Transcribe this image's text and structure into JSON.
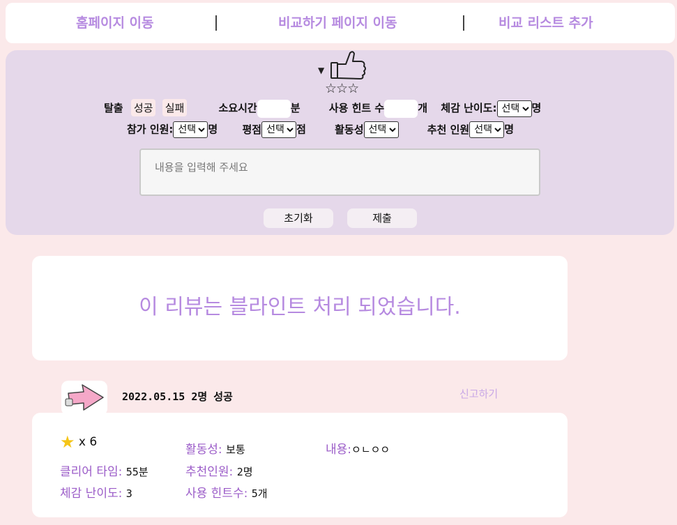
{
  "nav": {
    "home": "홈페이지 이동",
    "compare_page": "비교하기 페이지 이동",
    "add_compare": "비교 리스트 추가"
  },
  "form": {
    "stars": "☆☆☆",
    "escape_label": "탈출",
    "success": "성공",
    "fail": "실패",
    "time_label": "소요시간",
    "time_unit": "분",
    "hint_label": "사용 힌트 수",
    "hint_unit": "개",
    "difficulty_label": "체감 난이도:",
    "difficulty_unit": "명",
    "participants_label": "참가 인원:",
    "participants_unit": "명",
    "rating_label": "평점",
    "rating_unit": "점",
    "activity_label": "활동성",
    "recommend_label": "추천 인원",
    "recommend_unit": "명",
    "select_value": "선택",
    "content_placeholder": "내용을 입력해 주세요",
    "reset_button": "초기화",
    "submit_button": "제출"
  },
  "blind": {
    "message": "이 리뷰는 블라인트 처리 되었습니다."
  },
  "review": {
    "meta": "2022.05.15 2명 성공",
    "report": "신고하기",
    "star_count": "x 6",
    "activity_label": "활동성:",
    "activity_value": "보통",
    "content_label": "내용:",
    "content_value": "ㅇㄴㅇㅇ",
    "clear_time_label": "클리어 타임:",
    "clear_time_value": "55분",
    "recommend_label": "추천인원:",
    "recommend_value": "2명",
    "difficulty_label": "체감 난이도:",
    "difficulty_value": "3",
    "hints_label": "사용 힌트수:",
    "hints_value": "5개"
  },
  "colors": {
    "background": "#fbe9ea",
    "accent": "#b68ae0",
    "form_bg": "#e5d8ea",
    "label_purple": "#9b5cc8"
  }
}
